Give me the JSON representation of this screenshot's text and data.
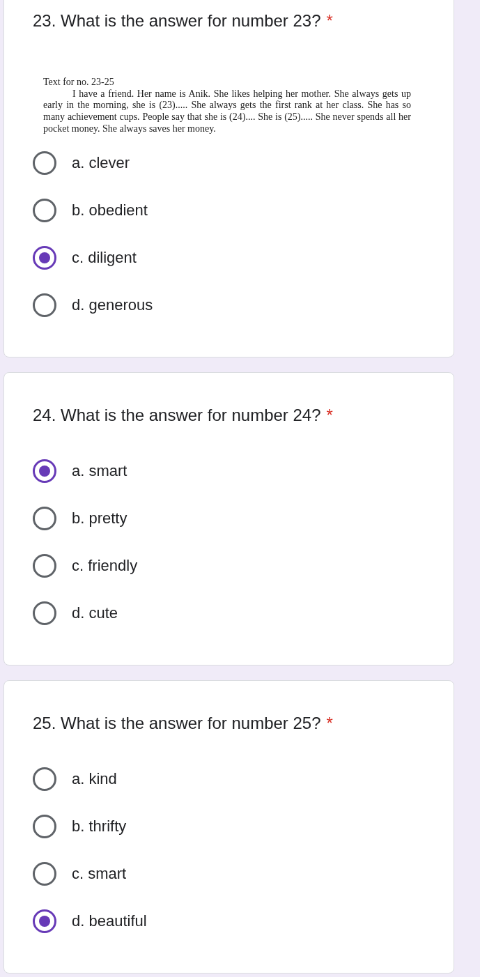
{
  "questions": [
    {
      "title": "23. What is the answer for number 23?",
      "required_mark": "*",
      "passage": {
        "heading": "Text for no. 23-25",
        "paragraph": "I have a friend. Her name is Anik. She likes helping her mother. She always gets up early in the morning, she is (23)..... She always gets the first rank at her class. She has so many achievement cups. People say that she is (24).... She is (25)..... She never spends all her pocket money. She always saves her money."
      },
      "options": [
        {
          "label": "a. clever",
          "selected": false
        },
        {
          "label": "b. obedient",
          "selected": false
        },
        {
          "label": "c. diligent",
          "selected": true
        },
        {
          "label": "d. generous",
          "selected": false
        }
      ]
    },
    {
      "title": "24. What is the answer for number 24?",
      "required_mark": "*",
      "options": [
        {
          "label": "a. smart",
          "selected": true
        },
        {
          "label": "b. pretty",
          "selected": false
        },
        {
          "label": "c. friendly",
          "selected": false
        },
        {
          "label": "d. cute",
          "selected": false
        }
      ]
    },
    {
      "title": "25. What is the answer for number 25?",
      "required_mark": "*",
      "options": [
        {
          "label": "a. kind",
          "selected": false
        },
        {
          "label": "b. thrifty",
          "selected": false
        },
        {
          "label": "c. smart",
          "selected": false
        },
        {
          "label": "d. beautiful",
          "selected": true
        }
      ]
    }
  ]
}
